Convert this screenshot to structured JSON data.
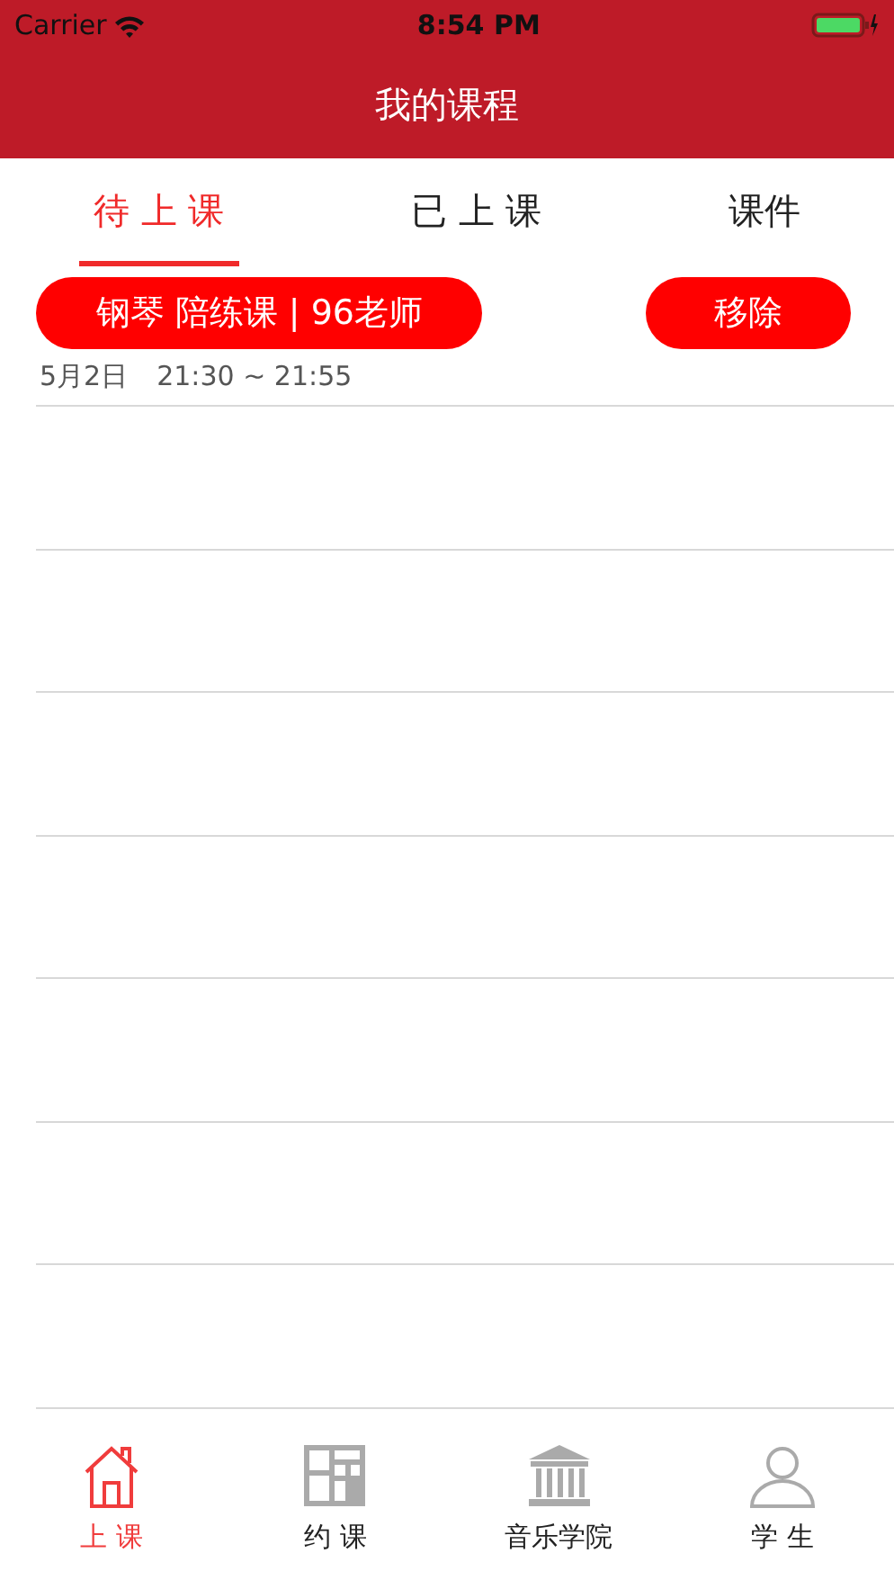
{
  "status_bar": {
    "carrier": "Carrier",
    "time": "8:54 PM"
  },
  "title": "我的课程",
  "tabs": [
    {
      "label": "待 上 课",
      "selected": true
    },
    {
      "label": "已 上 课",
      "selected": false
    },
    {
      "label": "课件",
      "selected": false
    }
  ],
  "lessons": [
    {
      "title": "钢琴 陪练课 | 96老师",
      "action": "移除",
      "date": "5月2日",
      "time": "21:30 ~ 21:55"
    }
  ],
  "tab_bar": [
    {
      "kind": "home",
      "label": "上 课",
      "selected": true
    },
    {
      "kind": "grid",
      "label": "约 课",
      "selected": false
    },
    {
      "kind": "building",
      "label": "音乐学院",
      "selected": false
    },
    {
      "kind": "person",
      "label": "学 生",
      "selected": false
    }
  ]
}
